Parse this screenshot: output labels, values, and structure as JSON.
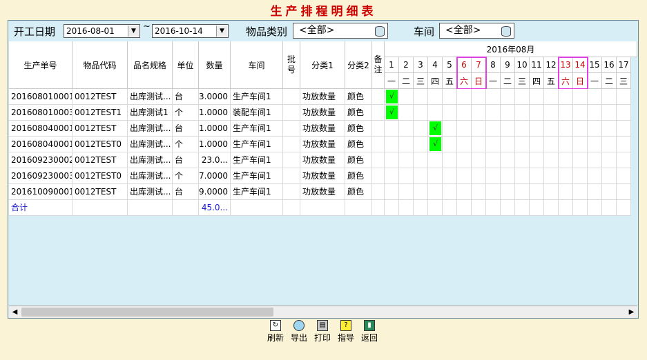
{
  "title": "生产排程明细表",
  "filters": {
    "start_label": "开工日期",
    "date_from": "2016-08-01",
    "tilde": "~",
    "date_to": "2016-10-14",
    "category_label": "物品类别",
    "category_value": "<全部>",
    "workshop_label": "车间",
    "workshop_value": "<全部>"
  },
  "columns": {
    "order": "生产单号",
    "code": "物品代码",
    "spec": "品名规格",
    "unit": "单位",
    "qty": "数量",
    "workshop": "车间",
    "batch": "批号",
    "cat1": "分类1",
    "cat2": "分类2",
    "remark": "备注"
  },
  "calendar": {
    "month": "2016年08月",
    "days": [
      "1",
      "2",
      "3",
      "4",
      "5",
      "6",
      "7",
      "8",
      "9",
      "10",
      "11",
      "12",
      "13",
      "14",
      "15",
      "16",
      "17"
    ],
    "weekdays": [
      "一",
      "二",
      "三",
      "四",
      "五",
      "六",
      "日",
      "一",
      "二",
      "三",
      "四",
      "五",
      "六",
      "日",
      "一",
      "二",
      "三"
    ],
    "weekend_indices": [
      5,
      6,
      12,
      13
    ]
  },
  "rows": [
    {
      "order": "201608010001",
      "code": "0012TEST",
      "spec": "出库测试...",
      "unit": "台",
      "qty": "3.0000",
      "workshop": "生产车间1",
      "batch": "",
      "cat1": "功放数量",
      "cat2": "颜色",
      "check_day": 0
    },
    {
      "order": "201608010003",
      "code": "0012TEST1",
      "spec": "出库测试1",
      "unit": "个",
      "qty": "1.0000",
      "workshop": "装配车间1",
      "batch": "",
      "cat1": "功放数量",
      "cat2": "颜色",
      "check_day": 0
    },
    {
      "order": "201608040001",
      "code": "0012TEST",
      "spec": "出库测试...",
      "unit": "台",
      "qty": "1.0000",
      "workshop": "生产车间1",
      "batch": "",
      "cat1": "功放数量",
      "cat2": "颜色",
      "check_day": 3
    },
    {
      "order": "201608040001",
      "code": "0012TEST0",
      "spec": "出库测试...",
      "unit": "个",
      "qty": "1.0000",
      "workshop": "生产车间1",
      "batch": "",
      "cat1": "功放数量",
      "cat2": "颜色",
      "check_day": 3
    },
    {
      "order": "201609230002",
      "code": "0012TEST",
      "spec": "出库测试...",
      "unit": "台",
      "qty": "23.0...",
      "workshop": "生产车间1",
      "batch": "",
      "cat1": "功放数量",
      "cat2": "颜色",
      "check_day": -1
    },
    {
      "order": "201609230003",
      "code": "0012TEST0",
      "spec": "出库测试...",
      "unit": "个",
      "qty": "7.0000",
      "workshop": "生产车间1",
      "batch": "",
      "cat1": "功放数量",
      "cat2": "颜色",
      "check_day": -1
    },
    {
      "order": "201610090001",
      "code": "0012TEST",
      "spec": "出库测试...",
      "unit": "台",
      "qty": "9.0000",
      "workshop": "生产车间1",
      "batch": "",
      "cat1": "功放数量",
      "cat2": "颜色",
      "check_day": -1
    }
  ],
  "check_mark": "√",
  "total": {
    "label": "合计",
    "qty": "45.0..."
  },
  "toolbar": {
    "refresh": "刷新",
    "export": "导出",
    "print": "打印",
    "guide": "指导",
    "back": "返回"
  },
  "colors": {
    "background": "#fbf3d6",
    "panel": "#d7eef7",
    "title": "#cc0000",
    "check": "#00ff00",
    "weekend_highlight": "#e040e0"
  }
}
